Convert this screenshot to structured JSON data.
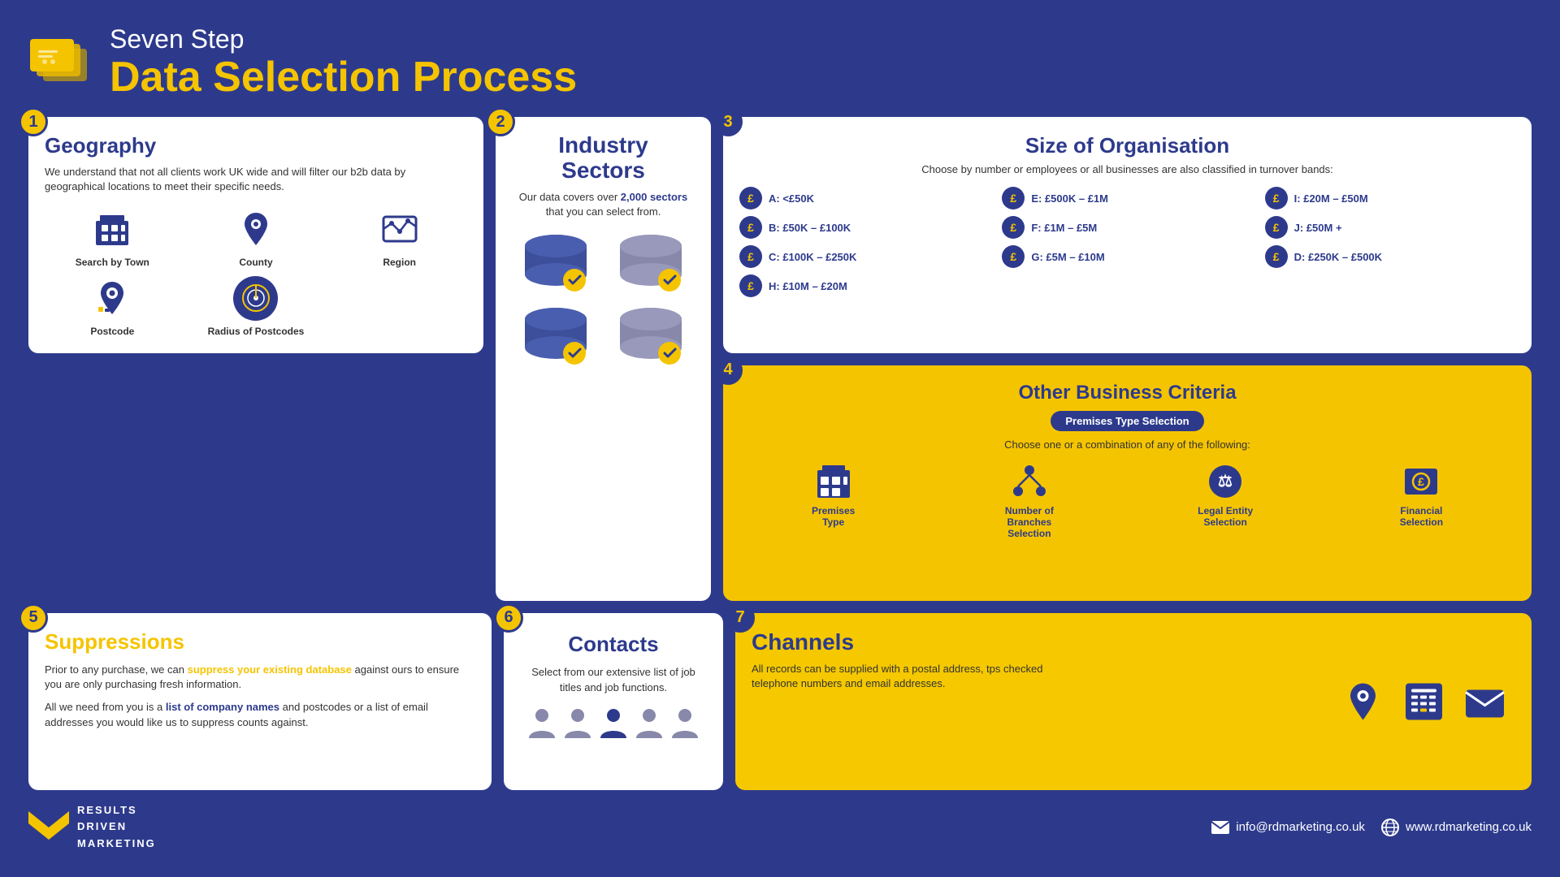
{
  "header": {
    "subtitle": "Seven Step",
    "title": "Data Selection Process"
  },
  "step1": {
    "number": "1",
    "title": "Geography",
    "description": "We understand that not all clients work UK wide and will filter our b2b data by geographical locations to meet their specific needs.",
    "icons": [
      {
        "label": "Search by Town"
      },
      {
        "label": "County"
      },
      {
        "label": "Region"
      },
      {
        "label": "Postcode"
      },
      {
        "label": "Radius of Postcodes"
      }
    ]
  },
  "step2": {
    "number": "2",
    "title": "Industry Sectors",
    "description": "Our data covers over 2,000 sectors that you can select from.",
    "description_bold": "2,000"
  },
  "step3": {
    "number": "3",
    "title": "Size of Organisation",
    "description": "Choose by number or employees or all businesses are also classified in turnover bands:",
    "bands": [
      {
        "label": "A: <£50K"
      },
      {
        "label": "B: £50K – £100K"
      },
      {
        "label": "C: £100K – £250K"
      },
      {
        "label": "D: £250K – £500K"
      },
      {
        "label": "E: £500K – £1M"
      },
      {
        "label": "F: £1M – £5M"
      },
      {
        "label": "G: £5M – £10M"
      },
      {
        "label": "H: £10M – £20M"
      },
      {
        "label": "I: £20M – £50M"
      },
      {
        "label": "J: £50M +"
      }
    ]
  },
  "step4": {
    "number": "4",
    "title": "Other Business Criteria",
    "badge": "Premises Type Selection",
    "description": "Choose one or a combination of any of the following:",
    "criteria": [
      {
        "label": "Premises Type"
      },
      {
        "label": "Number of Branches Selection"
      },
      {
        "label": "Legal Entity Selection"
      },
      {
        "label": "Financial Selection"
      }
    ]
  },
  "step5": {
    "number": "5",
    "title": "Suppressions",
    "para1": "Prior to any purchase, we can suppress your existing database against ours to ensure you are only purchasing fresh information.",
    "para1_highlight": "suppress your existing database",
    "para2_before": "All we need from you is a ",
    "para2_highlight": "list of company names",
    "para2_after": " and postcodes or a list of email addresses you would like us to suppress counts against."
  },
  "step6": {
    "number": "6",
    "title": "Contacts",
    "description": "Select from our extensive list of job titles and job functions."
  },
  "step7": {
    "number": "7",
    "title": "Channels",
    "description": "All records can be supplied with a postal address, tps checked telephone numbers and email addresses."
  },
  "footer": {
    "logo_line1": "RESULTS",
    "logo_line2": "DRIVEN",
    "logo_line3": "MARKETING",
    "email": "info@rdmarketing.co.uk",
    "website": "www.rdmarketing.co.uk"
  }
}
